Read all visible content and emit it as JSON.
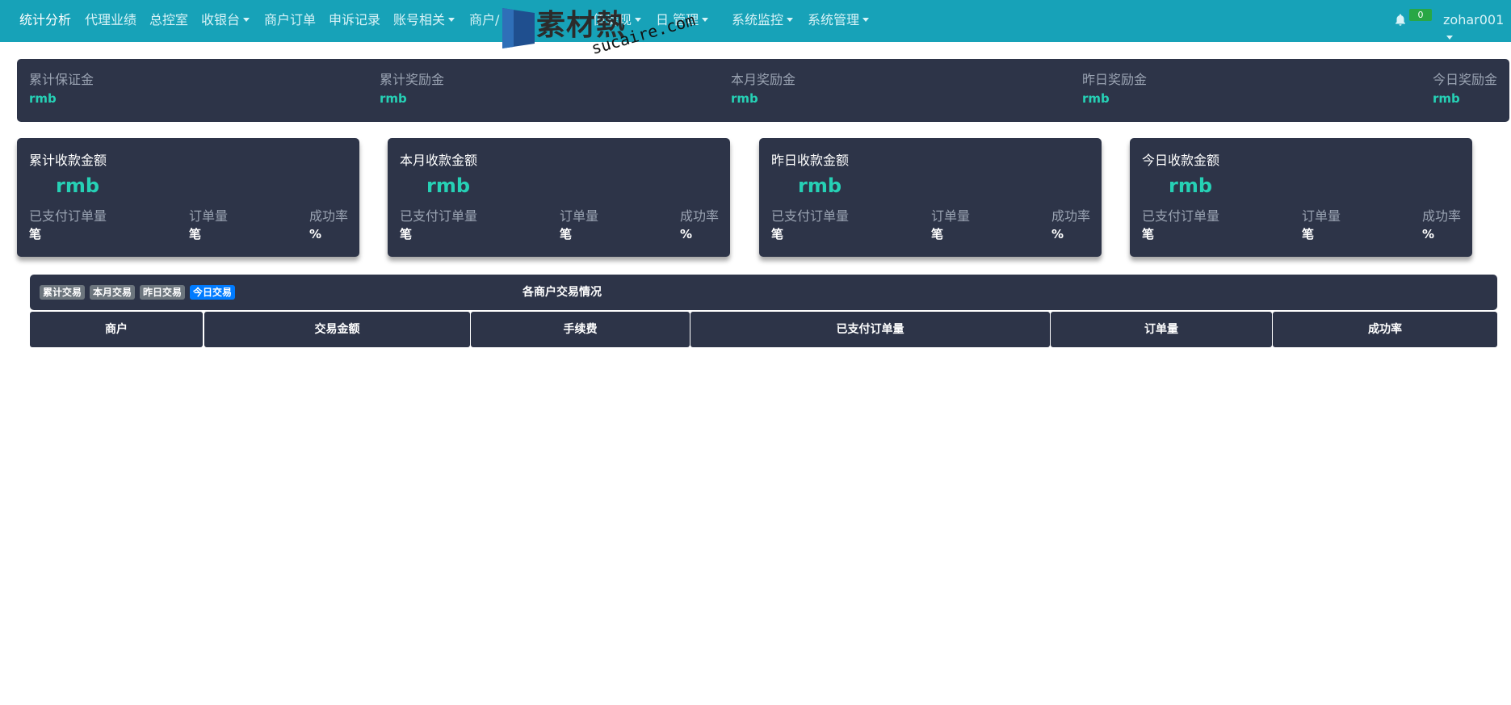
{
  "nav": {
    "items": [
      {
        "label": "统计分析",
        "dropdown": false,
        "active": true
      },
      {
        "label": "代理业绩",
        "dropdown": false
      },
      {
        "label": "总控室",
        "dropdown": false
      },
      {
        "label": "收银台",
        "dropdown": true
      },
      {
        "label": "商户订单",
        "dropdown": false
      },
      {
        "label": "申诉记录",
        "dropdown": false
      },
      {
        "label": "账号相关",
        "dropdown": true
      },
      {
        "label": "商户/",
        "dropdown": false
      },
      {
        "label": "值提现",
        "dropdown": true
      },
      {
        "label": "日 管理",
        "dropdown": true
      },
      {
        "label": "系统监控",
        "dropdown": true
      },
      {
        "label": "系统管理",
        "dropdown": true
      }
    ],
    "notification_icon": "bell-icon",
    "notification_count": "0",
    "user": "zohar001"
  },
  "watermark": {
    "logo_text": "素材熱",
    "url": "sucaire.com"
  },
  "summary": [
    {
      "label": "累计保证金",
      "unit": "rmb"
    },
    {
      "label": "累计奖励金",
      "unit": "rmb"
    },
    {
      "label": "本月奖励金",
      "unit": "rmb"
    },
    {
      "label": "昨日奖励金",
      "unit": "rmb"
    },
    {
      "label": "今日奖励金",
      "unit": "rmb"
    }
  ],
  "cards": [
    {
      "title": "累计收款金额",
      "amount_unit": "rmb",
      "paid_label": "已支付订单量",
      "paid_unit": "笔",
      "orders_label": "订单量",
      "orders_unit": "笔",
      "rate_label": "成功率",
      "rate_unit": "%"
    },
    {
      "title": "本月收款金额",
      "amount_unit": "rmb",
      "paid_label": "已支付订单量",
      "paid_unit": "笔",
      "orders_label": "订单量",
      "orders_unit": "笔",
      "rate_label": "成功率",
      "rate_unit": "%"
    },
    {
      "title": "昨日收款金额",
      "amount_unit": "rmb",
      "paid_label": "已支付订单量",
      "paid_unit": "笔",
      "orders_label": "订单量",
      "orders_unit": "笔",
      "rate_label": "成功率",
      "rate_unit": "%"
    },
    {
      "title": "今日收款金额",
      "amount_unit": "rmb",
      "paid_label": "已支付订单量",
      "paid_unit": "笔",
      "orders_label": "订单量",
      "orders_unit": "笔",
      "rate_label": "成功率",
      "rate_unit": "%"
    }
  ],
  "merchant": {
    "tabs": [
      "累计交易",
      "本月交易",
      "昨日交易",
      "今日交易"
    ],
    "active_tab": "今日交易",
    "title": "各商户交易情况",
    "columns": [
      "商户",
      "交易金额",
      "手续费",
      "已支付订单量",
      "订单量",
      "成功率"
    ]
  },
  "colors": {
    "nav": "#17a2b8",
    "panel": "#2d3448",
    "accent": "#26d0b5",
    "active_tab": "#007bff",
    "tab": "#6c757d",
    "badge": "#28a745"
  }
}
